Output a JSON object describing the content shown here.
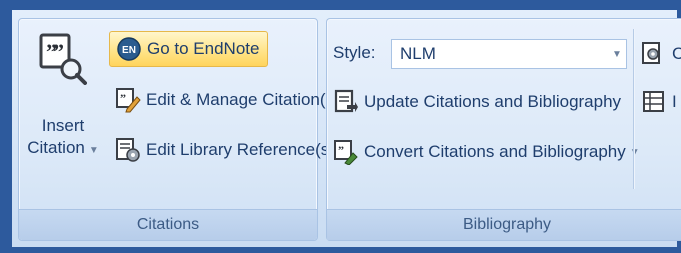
{
  "citations_group": {
    "label": "Citations",
    "insert_citation": {
      "line1": "Insert",
      "line2": "Citation"
    },
    "go_to_endnote": "Go to EndNote",
    "edit_manage": "Edit & Manage Citation(s)",
    "edit_library": "Edit Library Reference(s)"
  },
  "bibliography_group": {
    "label": "Bibliography",
    "style_label": "Style:",
    "style_value": "NLM",
    "update": "Update Citations and Bibliography",
    "convert": "Convert Citations and Bibliography",
    "cut_item_1": "C",
    "cut_item_2": "I"
  },
  "colors": {
    "frame": "#2d5a9d",
    "text": "#1f3e6d",
    "highlight": "#ffd45c"
  }
}
